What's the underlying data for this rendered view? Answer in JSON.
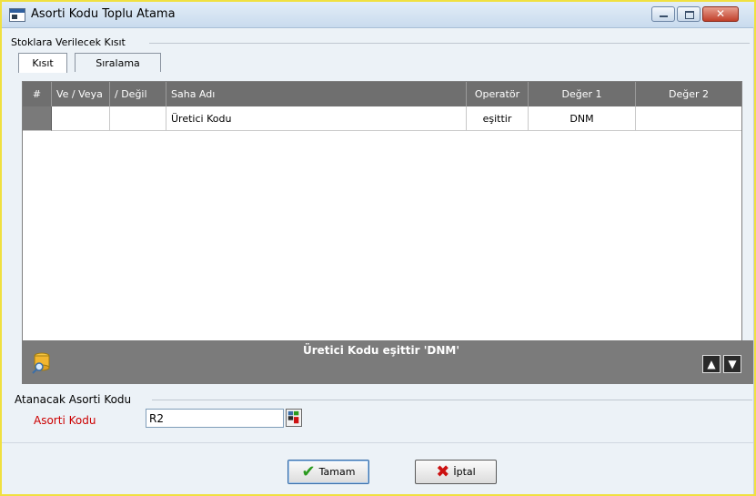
{
  "window": {
    "title": "Asorti Kodu Toplu Atama",
    "close_glyph": "✕"
  },
  "constraint_group": {
    "label": "Stoklara Verilecek Kısıt",
    "tabs": [
      {
        "label": "Kısıt",
        "active": true
      },
      {
        "label": "Sıralama",
        "active": false
      }
    ]
  },
  "grid": {
    "columns": [
      "#",
      "Ve / Veya",
      "/ Değil",
      "Saha Adı",
      "Operatör",
      "Değer 1",
      "Değer 2"
    ],
    "rows": [
      {
        "num": "",
        "and_or": "",
        "not": "",
        "field_name": "Üretici Kodu",
        "operator": "eşittir",
        "value1": "DNM",
        "value2": ""
      }
    ]
  },
  "filter_bar": {
    "summary": "Üretici Kodu eşittir 'DNM'",
    "icon": "filter-database-icon",
    "up_glyph": "▲",
    "down_glyph": "▼"
  },
  "assign_group": {
    "label": "Atanacak Asorti Kodu",
    "field_label": "Asorti Kodu",
    "field_value": "R2"
  },
  "buttons": {
    "ok_label": "Tamam",
    "cancel_label": "İptal"
  },
  "colors": {
    "frame_highlight": "#f0e040",
    "grid_header": "#6f6f6f",
    "filter_bar": "#7b7b7b",
    "required_label": "#cc0000",
    "ok_check": "#2a9a1e",
    "cancel_x": "#cc1111"
  }
}
